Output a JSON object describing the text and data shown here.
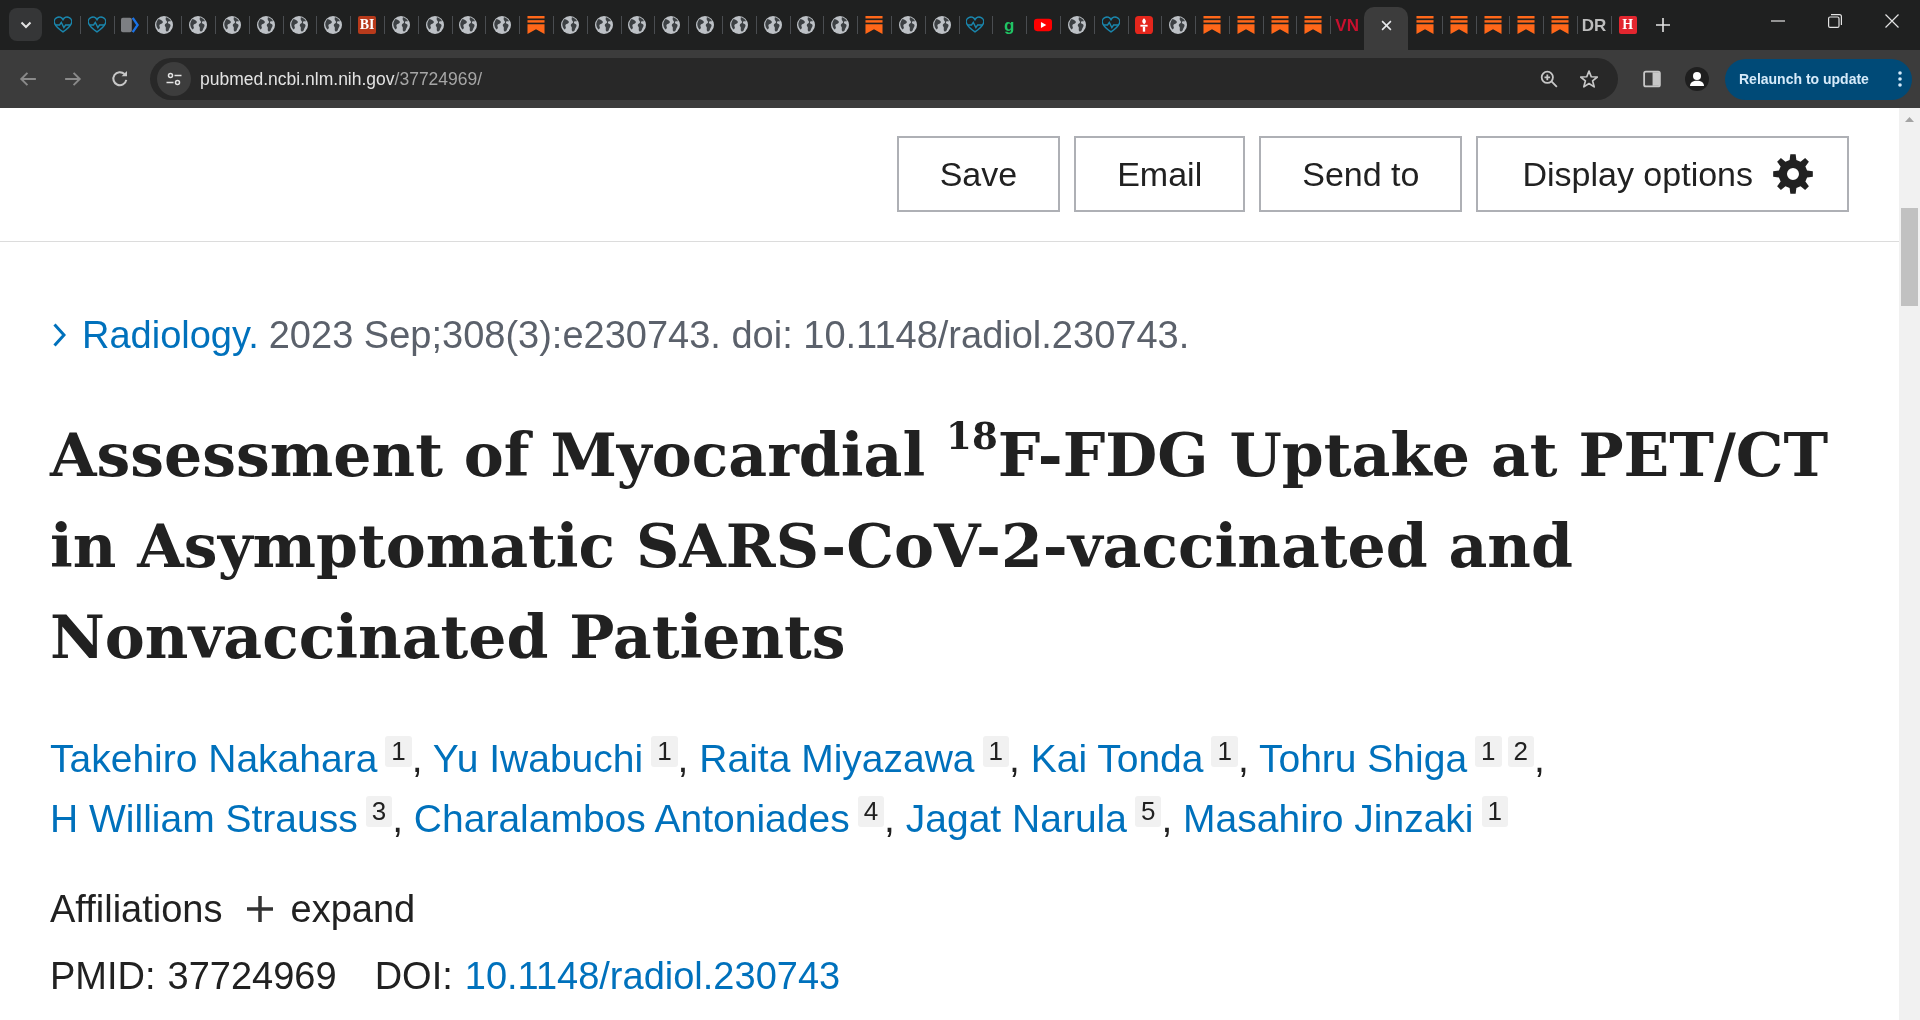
{
  "browser": {
    "tabs": [
      {
        "kind": "heart",
        "selected": false
      },
      {
        "kind": "heart",
        "selected": false
      },
      {
        "kind": "arrow",
        "selected": false
      },
      {
        "kind": "globe",
        "selected": false
      },
      {
        "kind": "globe",
        "selected": false
      },
      {
        "kind": "globe",
        "selected": false
      },
      {
        "kind": "globe",
        "selected": false
      },
      {
        "kind": "globe",
        "selected": false
      },
      {
        "kind": "globe",
        "selected": false
      },
      {
        "kind": "tile",
        "text": "BI",
        "color": "#b83a1b",
        "selected": false
      },
      {
        "kind": "globe",
        "selected": false
      },
      {
        "kind": "globe",
        "selected": false
      },
      {
        "kind": "globe",
        "selected": false
      },
      {
        "kind": "globe",
        "selected": false
      },
      {
        "kind": "bookmark",
        "selected": false
      },
      {
        "kind": "globe",
        "selected": false
      },
      {
        "kind": "globe",
        "selected": false
      },
      {
        "kind": "globe",
        "selected": false
      },
      {
        "kind": "globe",
        "selected": false
      },
      {
        "kind": "globe",
        "selected": false
      },
      {
        "kind": "globe",
        "selected": false
      },
      {
        "kind": "globe",
        "selected": false
      },
      {
        "kind": "globe",
        "selected": false
      },
      {
        "kind": "globe",
        "selected": false
      },
      {
        "kind": "bookmark",
        "selected": false
      },
      {
        "kind": "globe",
        "selected": false
      },
      {
        "kind": "globe",
        "selected": false
      },
      {
        "kind": "heart",
        "selected": false
      },
      {
        "kind": "letters",
        "text": "g",
        "color": "#20c464",
        "selected": false
      },
      {
        "kind": "play",
        "selected": false
      },
      {
        "kind": "globe",
        "selected": false
      },
      {
        "kind": "heart",
        "selected": false
      },
      {
        "kind": "torch",
        "selected": false
      },
      {
        "kind": "globe",
        "selected": false
      },
      {
        "kind": "bookmark",
        "selected": false
      },
      {
        "kind": "bookmark",
        "selected": false
      },
      {
        "kind": "bookmark",
        "selected": false
      },
      {
        "kind": "bookmark",
        "selected": false
      },
      {
        "kind": "letters",
        "text": "VN",
        "color": "#c8102e",
        "selected": false
      },
      {
        "selected": true
      },
      {
        "kind": "bookmark",
        "selected": false
      },
      {
        "kind": "bookmark",
        "selected": false
      },
      {
        "kind": "bookmark",
        "selected": false
      },
      {
        "kind": "bookmark",
        "selected": false
      },
      {
        "kind": "bookmark",
        "selected": false
      },
      {
        "kind": "letters",
        "text": "DR",
        "color": "#bdbdbd",
        "selected": false
      },
      {
        "kind": "tile",
        "text": "H",
        "color": "#e3262f",
        "selected": false
      }
    ],
    "toolbar": {
      "back": {
        "disabled": true
      },
      "forward": {
        "disabled": true
      },
      "url_host": "pubmed.ncbi.nlm.nih.gov",
      "url_path": "/37724969/",
      "relaunch": "Relaunch to update"
    }
  },
  "page": {
    "actions": [
      {
        "label": "Save",
        "kind": "plain"
      },
      {
        "label": "Email",
        "kind": "plain"
      },
      {
        "label": "Send to",
        "kind": "plain"
      },
      {
        "label": "Display options",
        "kind": "settings"
      }
    ],
    "citation": {
      "journal": "Radiology.",
      "details": "2023 Sep;308(3):e230743. doi: 10.1148/radiol.230743."
    },
    "title": "Assessment of Myocardial $^{18}$F-FDG Uptake at PET/CT in Asymptomatic SARS-CoV-2-vaccinated and Nonvaccinated Patients",
    "authors": [
      {
        "name": "Takehiro Nakahara",
        "affiliations": [
          "1"
        ],
        "after": ","
      },
      {
        "name": "Yu Iwabuchi",
        "affiliations": [
          "1"
        ],
        "after": ","
      },
      {
        "name": "Raita Miyazawa",
        "affiliations": [
          "1"
        ],
        "after": ","
      },
      {
        "name": "Kai Tonda",
        "affiliations": [
          "1"
        ],
        "after": ","
      },
      {
        "name": "Tohru Shiga",
        "affiliations": [
          "1",
          "2"
        ],
        "after": ","
      },
      {
        "name": "H William Strauss",
        "affiliations": [
          "3"
        ],
        "after": ","
      },
      {
        "name": "Charalambos Antoniades",
        "affiliations": [
          "4"
        ],
        "after": ","
      },
      {
        "name": "Jagat Narula",
        "affiliations": [
          "5"
        ],
        "after": ","
      },
      {
        "name": "Masahiro Jinzaki",
        "affiliations": [
          "1"
        ]
      }
    ],
    "affiliations": {
      "label": "Affiliations",
      "toggle": "expand",
      "expanded": false
    },
    "ids": {
      "pmid_label": "PMID:",
      "pmid": "37724969",
      "doi_label": "DOI:",
      "doi": "10.1148/radiol.230743"
    }
  }
}
